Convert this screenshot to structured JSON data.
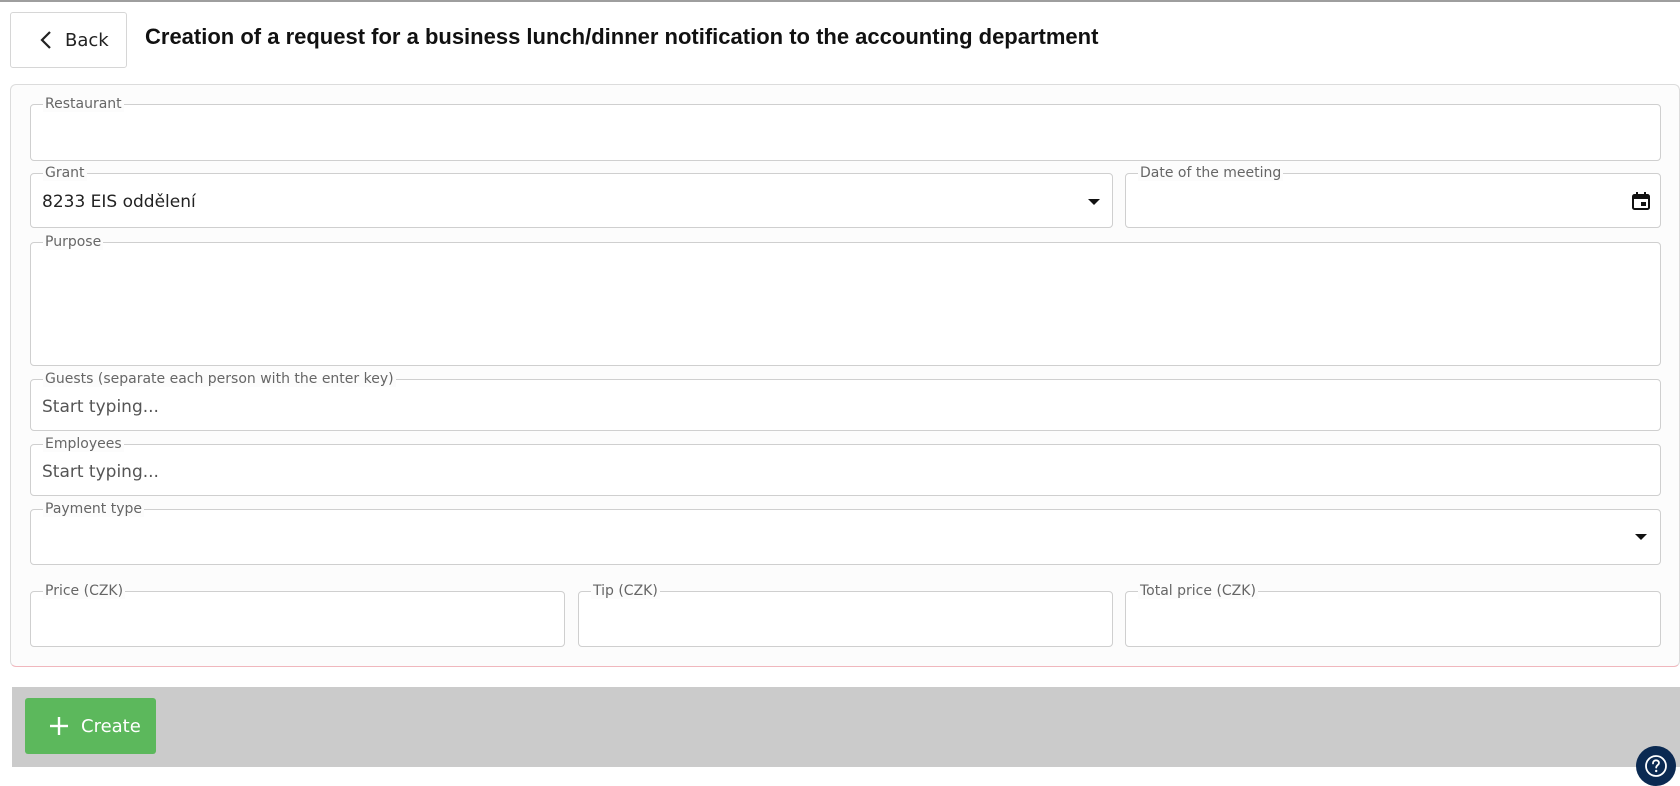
{
  "header": {
    "back_label": "Back",
    "title": "Creation of a request for a business lunch/dinner notification to the accounting department"
  },
  "form": {
    "restaurant": {
      "label": "Restaurant",
      "value": ""
    },
    "grant": {
      "label": "Grant",
      "value": "8233 EIS oddělení"
    },
    "date": {
      "label": "Date of the meeting",
      "value": ""
    },
    "purpose": {
      "label": "Purpose",
      "value": ""
    },
    "guests": {
      "label": "Guests (separate each person with the enter key)",
      "placeholder": "Start typing..."
    },
    "employees": {
      "label": "Employees",
      "placeholder": "Start typing..."
    },
    "payment_type": {
      "label": "Payment type",
      "value": ""
    },
    "price": {
      "label": "Price (CZK)",
      "value": ""
    },
    "tip": {
      "label": "Tip (CZK)",
      "value": ""
    },
    "total_price": {
      "label": "Total price (CZK)",
      "value": ""
    }
  },
  "footer": {
    "create_label": "Create"
  },
  "icons": {
    "back": "chevron-left-icon",
    "calendar": "calendar-icon",
    "dropdown": "caret-down-icon",
    "create": "plus-icon",
    "help": "question-icon"
  },
  "colors": {
    "create_button": "#5cb85c",
    "footer_bar": "#cbcbcb",
    "help_button": "#0b2a52"
  }
}
